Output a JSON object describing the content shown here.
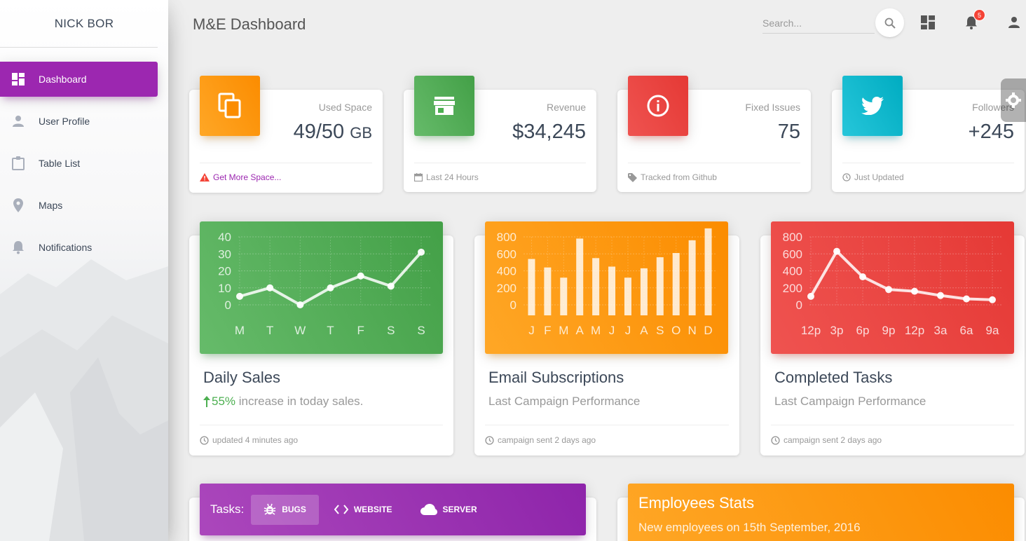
{
  "sidebar": {
    "brand": "NICK BOR",
    "items": [
      {
        "label": "Dashboard",
        "icon": "dashboard-icon",
        "active": true
      },
      {
        "label": "User Profile",
        "icon": "person-icon"
      },
      {
        "label": "Table List",
        "icon": "clipboard-icon"
      },
      {
        "label": "Maps",
        "icon": "location-pin-icon"
      },
      {
        "label": "Notifications",
        "icon": "bell-icon"
      }
    ]
  },
  "header": {
    "title": "M&E Dashboard",
    "search_placeholder": "Search...",
    "notification_count": "5"
  },
  "stats": [
    {
      "category": "Used Space",
      "value": "49/50",
      "unit": "GB",
      "footer": "Get More Space...",
      "footer_icon": "warning-icon",
      "icon": "content-copy-icon",
      "color": "#fb8c00"
    },
    {
      "category": "Revenue",
      "value": "$34,245",
      "footer": "Last 24 Hours",
      "footer_icon": "calendar-icon",
      "icon": "store-icon",
      "color": "#43a047"
    },
    {
      "category": "Fixed Issues",
      "value": "75",
      "footer": "Tracked from Github",
      "footer_icon": "tag-icon",
      "icon": "info-icon",
      "color": "#e53935"
    },
    {
      "category": "Followers",
      "value": "+245",
      "footer": "Just Updated",
      "footer_icon": "update-icon",
      "icon": "twitter-icon",
      "color": "#00acc1"
    }
  ],
  "charts": [
    {
      "title": "Daily Sales",
      "percent": "55%",
      "subtitle": " increase in today sales.",
      "footer": "updated 4 minutes ago"
    },
    {
      "title": "Email Subscriptions",
      "subtitle": "Last Campaign Performance",
      "footer": "campaign sent 2 days ago"
    },
    {
      "title": "Completed Tasks",
      "subtitle": "Last Campaign Performance",
      "footer": "campaign sent 2 days ago"
    }
  ],
  "chart_data": [
    {
      "type": "line",
      "categories": [
        "M",
        "T",
        "W",
        "T",
        "F",
        "S",
        "S"
      ],
      "values": [
        5,
        10,
        0,
        10,
        17,
        11,
        31
      ],
      "ylim": [
        0,
        40
      ],
      "yticks": [
        "40",
        "30",
        "20",
        "10",
        "0"
      ],
      "grid": true
    },
    {
      "type": "bar",
      "categories": [
        "J",
        "F",
        "M",
        "A",
        "M",
        "J",
        "J",
        "A",
        "S",
        "O",
        "N",
        "D"
      ],
      "values": [
        540,
        440,
        320,
        780,
        550,
        450,
        320,
        430,
        560,
        610,
        760,
        900
      ],
      "ylim": [
        0,
        800
      ],
      "yticks": [
        "800",
        "600",
        "400",
        "200",
        "0"
      ],
      "grid": true
    },
    {
      "type": "line",
      "categories": [
        "12p",
        "3p",
        "6p",
        "9p",
        "12p",
        "3a",
        "6a",
        "9a"
      ],
      "values": [
        100,
        630,
        330,
        180,
        160,
        110,
        70,
        60
      ],
      "ylim": [
        0,
        800
      ],
      "yticks": [
        "800",
        "600",
        "400",
        "200",
        "0"
      ],
      "grid": true
    }
  ],
  "tasks": {
    "label": "Tasks:",
    "tabs": [
      {
        "label": "BUGS",
        "icon": "bug-icon",
        "active": true
      },
      {
        "label": "WEBSITE",
        "icon": "code-icon"
      },
      {
        "label": "SERVER",
        "icon": "cloud-icon"
      }
    ]
  },
  "employees": {
    "title": "Employees Stats",
    "subtitle": "New employees on 15th September, 2016"
  }
}
